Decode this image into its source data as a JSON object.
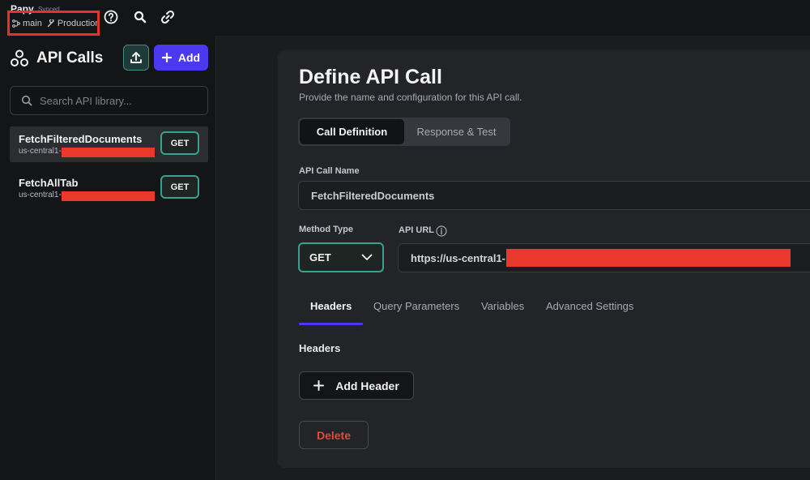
{
  "project": {
    "name": "Papy",
    "sync_status": "Synced",
    "branch": "main",
    "environment": "Production"
  },
  "topbar": {
    "icons": [
      "help-icon",
      "search-icon",
      "link-icon"
    ]
  },
  "sidebar": {
    "title": "API Calls",
    "add_label": "Add",
    "search_placeholder": "Search API library...",
    "items": [
      {
        "name": "FetchFilteredDocuments",
        "region": "us-central1-",
        "method": "GET",
        "selected": true
      },
      {
        "name": "FetchAllTab",
        "region": "us-central1-",
        "method": "GET",
        "selected": false
      }
    ]
  },
  "main": {
    "title": "Define API Call",
    "subtitle": "Provide the name and configuration for this API call.",
    "segments": [
      "Call Definition",
      "Response & Test"
    ],
    "api_call_name_label": "API Call Name",
    "api_call_name_value": "FetchFilteredDocuments",
    "method_label": "Method Type",
    "method_value": "GET",
    "url_label": "API URL",
    "url_value": "https://us-central1-",
    "tabs": [
      "Headers",
      "Query Parameters",
      "Variables",
      "Advanced Settings"
    ],
    "active_tab": "Headers",
    "section_label": "Headers",
    "add_header_label": "Add Header",
    "delete_label": "Delete"
  },
  "colors": {
    "accent": "#4b39ef",
    "teal": "#39a190",
    "redaction": "#e8392c",
    "delete": "#e04a3f"
  }
}
